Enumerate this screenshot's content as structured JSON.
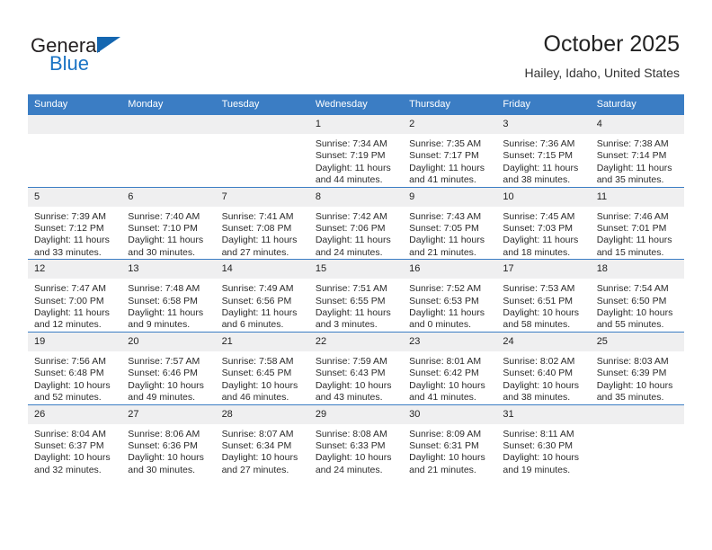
{
  "brand": {
    "name_top": "General",
    "name_bottom": "Blue",
    "triangle_color": "#1466b0",
    "blue_color": "#1a73c4"
  },
  "header": {
    "title": "October 2025",
    "subtitle": "Hailey, Idaho, United States",
    "header_bg": "#3b7dc4"
  },
  "weekdays": [
    "Sunday",
    "Monday",
    "Tuesday",
    "Wednesday",
    "Thursday",
    "Friday",
    "Saturday"
  ],
  "weeks": [
    [
      {
        "day": "",
        "empty": true,
        "lines": []
      },
      {
        "day": "",
        "empty": true,
        "lines": []
      },
      {
        "day": "",
        "empty": true,
        "lines": []
      },
      {
        "day": "1",
        "empty": false,
        "lines": [
          "Sunrise: 7:34 AM",
          "Sunset: 7:19 PM",
          "Daylight: 11 hours",
          "and 44 minutes."
        ]
      },
      {
        "day": "2",
        "empty": false,
        "lines": [
          "Sunrise: 7:35 AM",
          "Sunset: 7:17 PM",
          "Daylight: 11 hours",
          "and 41 minutes."
        ]
      },
      {
        "day": "3",
        "empty": false,
        "lines": [
          "Sunrise: 7:36 AM",
          "Sunset: 7:15 PM",
          "Daylight: 11 hours",
          "and 38 minutes."
        ]
      },
      {
        "day": "4",
        "empty": false,
        "lines": [
          "Sunrise: 7:38 AM",
          "Sunset: 7:14 PM",
          "Daylight: 11 hours",
          "and 35 minutes."
        ]
      }
    ],
    [
      {
        "day": "5",
        "empty": false,
        "lines": [
          "Sunrise: 7:39 AM",
          "Sunset: 7:12 PM",
          "Daylight: 11 hours",
          "and 33 minutes."
        ]
      },
      {
        "day": "6",
        "empty": false,
        "lines": [
          "Sunrise: 7:40 AM",
          "Sunset: 7:10 PM",
          "Daylight: 11 hours",
          "and 30 minutes."
        ]
      },
      {
        "day": "7",
        "empty": false,
        "lines": [
          "Sunrise: 7:41 AM",
          "Sunset: 7:08 PM",
          "Daylight: 11 hours",
          "and 27 minutes."
        ]
      },
      {
        "day": "8",
        "empty": false,
        "lines": [
          "Sunrise: 7:42 AM",
          "Sunset: 7:06 PM",
          "Daylight: 11 hours",
          "and 24 minutes."
        ]
      },
      {
        "day": "9",
        "empty": false,
        "lines": [
          "Sunrise: 7:43 AM",
          "Sunset: 7:05 PM",
          "Daylight: 11 hours",
          "and 21 minutes."
        ]
      },
      {
        "day": "10",
        "empty": false,
        "lines": [
          "Sunrise: 7:45 AM",
          "Sunset: 7:03 PM",
          "Daylight: 11 hours",
          "and 18 minutes."
        ]
      },
      {
        "day": "11",
        "empty": false,
        "lines": [
          "Sunrise: 7:46 AM",
          "Sunset: 7:01 PM",
          "Daylight: 11 hours",
          "and 15 minutes."
        ]
      }
    ],
    [
      {
        "day": "12",
        "empty": false,
        "lines": [
          "Sunrise: 7:47 AM",
          "Sunset: 7:00 PM",
          "Daylight: 11 hours",
          "and 12 minutes."
        ]
      },
      {
        "day": "13",
        "empty": false,
        "lines": [
          "Sunrise: 7:48 AM",
          "Sunset: 6:58 PM",
          "Daylight: 11 hours",
          "and 9 minutes."
        ]
      },
      {
        "day": "14",
        "empty": false,
        "lines": [
          "Sunrise: 7:49 AM",
          "Sunset: 6:56 PM",
          "Daylight: 11 hours",
          "and 6 minutes."
        ]
      },
      {
        "day": "15",
        "empty": false,
        "lines": [
          "Sunrise: 7:51 AM",
          "Sunset: 6:55 PM",
          "Daylight: 11 hours",
          "and 3 minutes."
        ]
      },
      {
        "day": "16",
        "empty": false,
        "lines": [
          "Sunrise: 7:52 AM",
          "Sunset: 6:53 PM",
          "Daylight: 11 hours",
          "and 0 minutes."
        ]
      },
      {
        "day": "17",
        "empty": false,
        "lines": [
          "Sunrise: 7:53 AM",
          "Sunset: 6:51 PM",
          "Daylight: 10 hours",
          "and 58 minutes."
        ]
      },
      {
        "day": "18",
        "empty": false,
        "lines": [
          "Sunrise: 7:54 AM",
          "Sunset: 6:50 PM",
          "Daylight: 10 hours",
          "and 55 minutes."
        ]
      }
    ],
    [
      {
        "day": "19",
        "empty": false,
        "lines": [
          "Sunrise: 7:56 AM",
          "Sunset: 6:48 PM",
          "Daylight: 10 hours",
          "and 52 minutes."
        ]
      },
      {
        "day": "20",
        "empty": false,
        "lines": [
          "Sunrise: 7:57 AM",
          "Sunset: 6:46 PM",
          "Daylight: 10 hours",
          "and 49 minutes."
        ]
      },
      {
        "day": "21",
        "empty": false,
        "lines": [
          "Sunrise: 7:58 AM",
          "Sunset: 6:45 PM",
          "Daylight: 10 hours",
          "and 46 minutes."
        ]
      },
      {
        "day": "22",
        "empty": false,
        "lines": [
          "Sunrise: 7:59 AM",
          "Sunset: 6:43 PM",
          "Daylight: 10 hours",
          "and 43 minutes."
        ]
      },
      {
        "day": "23",
        "empty": false,
        "lines": [
          "Sunrise: 8:01 AM",
          "Sunset: 6:42 PM",
          "Daylight: 10 hours",
          "and 41 minutes."
        ]
      },
      {
        "day": "24",
        "empty": false,
        "lines": [
          "Sunrise: 8:02 AM",
          "Sunset: 6:40 PM",
          "Daylight: 10 hours",
          "and 38 minutes."
        ]
      },
      {
        "day": "25",
        "empty": false,
        "lines": [
          "Sunrise: 8:03 AM",
          "Sunset: 6:39 PM",
          "Daylight: 10 hours",
          "and 35 minutes."
        ]
      }
    ],
    [
      {
        "day": "26",
        "empty": false,
        "lines": [
          "Sunrise: 8:04 AM",
          "Sunset: 6:37 PM",
          "Daylight: 10 hours",
          "and 32 minutes."
        ]
      },
      {
        "day": "27",
        "empty": false,
        "lines": [
          "Sunrise: 8:06 AM",
          "Sunset: 6:36 PM",
          "Daylight: 10 hours",
          "and 30 minutes."
        ]
      },
      {
        "day": "28",
        "empty": false,
        "lines": [
          "Sunrise: 8:07 AM",
          "Sunset: 6:34 PM",
          "Daylight: 10 hours",
          "and 27 minutes."
        ]
      },
      {
        "day": "29",
        "empty": false,
        "lines": [
          "Sunrise: 8:08 AM",
          "Sunset: 6:33 PM",
          "Daylight: 10 hours",
          "and 24 minutes."
        ]
      },
      {
        "day": "30",
        "empty": false,
        "lines": [
          "Sunrise: 8:09 AM",
          "Sunset: 6:31 PM",
          "Daylight: 10 hours",
          "and 21 minutes."
        ]
      },
      {
        "day": "31",
        "empty": false,
        "lines": [
          "Sunrise: 8:11 AM",
          "Sunset: 6:30 PM",
          "Daylight: 10 hours",
          "and 19 minutes."
        ]
      },
      {
        "day": "",
        "empty": true,
        "lines": []
      }
    ]
  ]
}
